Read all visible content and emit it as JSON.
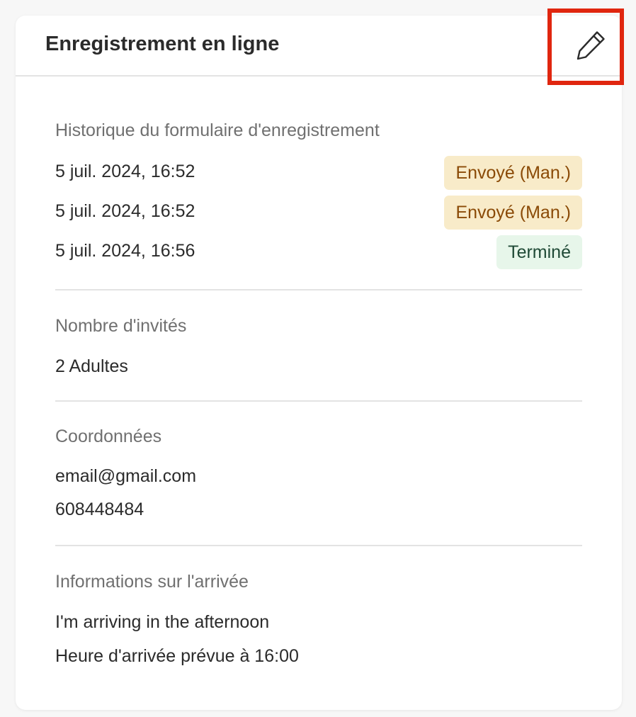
{
  "header": {
    "title": "Enregistrement en ligne",
    "edit_icon": "pencil-icon"
  },
  "history": {
    "label": "Historique du formulaire d'enregistrement",
    "rows": [
      {
        "date": "5 juil. 2024, 16:52",
        "status": "Envoyé (Man.)",
        "status_type": "warning"
      },
      {
        "date": "5 juil. 2024, 16:52",
        "status": "Envoyé (Man.)",
        "status_type": "warning"
      },
      {
        "date": "5 juil. 2024, 16:56",
        "status": "Terminé",
        "status_type": "success"
      }
    ]
  },
  "guests": {
    "label": "Nombre d'invités",
    "value": "2 Adultes"
  },
  "contact": {
    "label": "Coordonnées",
    "email": "email@gmail.com",
    "phone": "608448484"
  },
  "arrival": {
    "label": "Informations sur l'arrivée",
    "note": "I'm arriving in the afternoon",
    "expected_time": "Heure d'arrivée prévue à 16:00"
  },
  "colors": {
    "highlight": "#e0260f",
    "warning_bg": "#f8ebc9",
    "warning_text": "#8a4a06",
    "success_bg": "#e7f6ea",
    "success_text": "#1f4a36"
  }
}
